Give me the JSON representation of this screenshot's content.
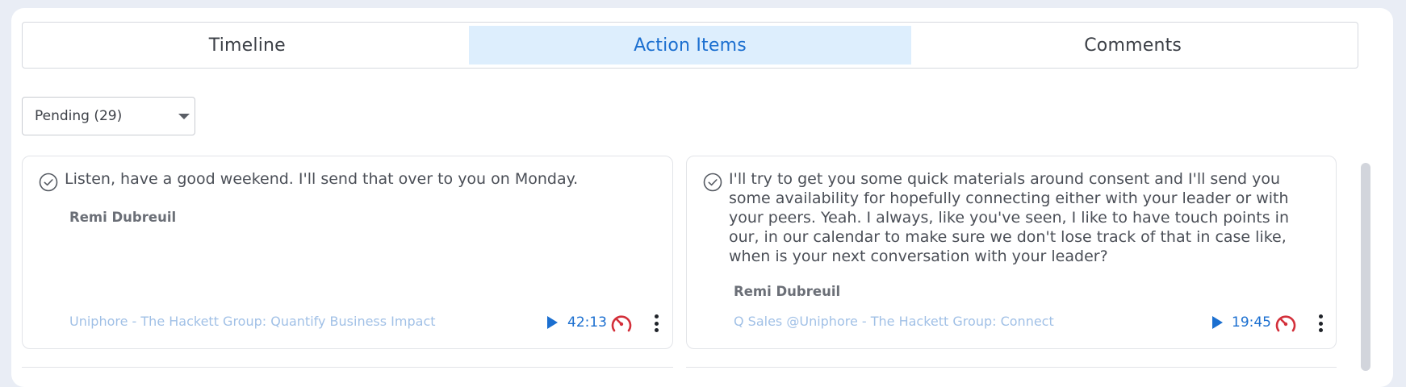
{
  "tabs": [
    {
      "label": "Timeline",
      "active": false
    },
    {
      "label": "Action Items",
      "active": true
    },
    {
      "label": "Comments",
      "active": false
    }
  ],
  "filter": {
    "selected": "Pending (29)"
  },
  "colors": {
    "accent": "#1b6fd0",
    "active_tab_bg": "#ddeefd",
    "page_bg": "#e9edf5",
    "alert": "#d32f3a"
  },
  "action_items": [
    {
      "text": "Listen, have a good weekend. I'll send that over to you on Monday.",
      "owner": "Remi Dubreuil",
      "meeting": "Uniphore - The Hackett Group: Quantify Business Impact",
      "time": "42:13",
      "icons": [
        "check-circle-icon",
        "play-icon",
        "gauge-icon",
        "more-vertical-icon"
      ]
    },
    {
      "text": "I'll try to get you some quick materials around consent and I'll send you some availability for hopefully connecting either with your leader or with your peers. Yeah. I always, like you've seen, I like to have touch points in our, in our calendar to make sure we don't lose track of that in case like, when is your next conversation with your leader?",
      "owner": "Remi Dubreuil",
      "meeting": "Q Sales @Uniphore - The Hackett Group: Connect",
      "time": "19:45",
      "icons": [
        "check-circle-icon",
        "play-icon",
        "gauge-icon",
        "more-vertical-icon"
      ]
    }
  ]
}
